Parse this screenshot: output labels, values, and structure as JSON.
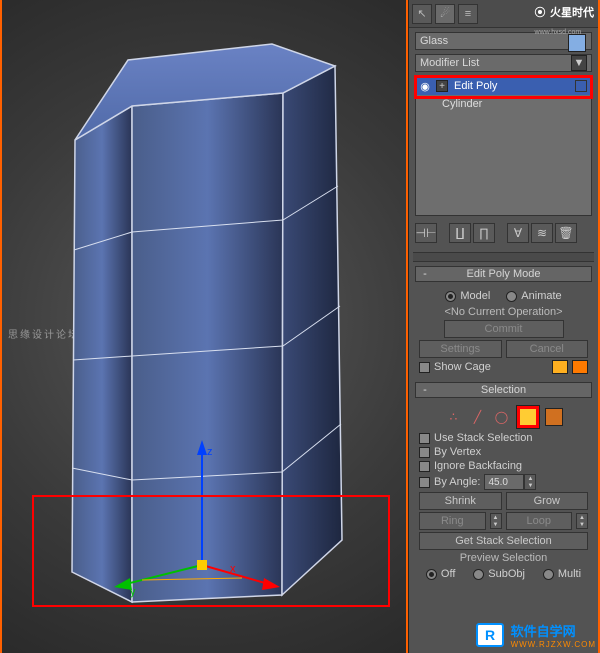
{
  "watermarks": {
    "left_text": "思缘设计论坛  WWW.MISSYUAN.COM",
    "brand_cn": "软件自学网",
    "brand_url": "WWW.RJZXW.COM",
    "top_brand": "火星时代",
    "top_brand_url": "www.hxsd.com"
  },
  "object_name": "Glass",
  "modifier_list_label": "Modifier List",
  "stack": {
    "items": [
      {
        "label": "Edit Poly",
        "selected": true
      },
      {
        "label": "Cylinder",
        "selected": false
      }
    ]
  },
  "rollouts": {
    "edit_poly_mode": {
      "title": "Edit Poly Mode",
      "model": "Model",
      "animate": "Animate",
      "no_op": "<No Current Operation>",
      "commit": "Commit",
      "settings": "Settings",
      "cancel": "Cancel",
      "show_cage": "Show Cage"
    },
    "selection": {
      "title": "Selection",
      "use_stack": "Use Stack Selection",
      "by_vertex": "By Vertex",
      "ignore_backfacing": "Ignore Backfacing",
      "by_angle": "By Angle:",
      "angle_value": "45.0",
      "shrink": "Shrink",
      "grow": "Grow",
      "ring": "Ring",
      "loop": "Loop",
      "get_stack": "Get Stack Selection",
      "preview": "Preview Selection",
      "off": "Off",
      "subobj": "SubObj",
      "multi": "Multi"
    }
  }
}
